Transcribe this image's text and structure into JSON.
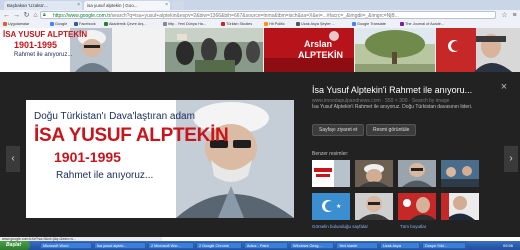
{
  "browser": {
    "tabs": [
      {
        "label": "Başbakan 'Uzakta'...",
        "active": false
      },
      {
        "label": "isa yusuf alptekin | Goo...",
        "active": true
      }
    ],
    "url_domain": "https://www.google.com.tr",
    "url_path": "/search?q=isa+yusuf+alptekin&espv=2&biw=1366&bih=667&source=lnms&tbm=isch&sa=X&ei=...#facrc=_&imgdii=_&imgrc=NjB...",
    "bookmarks": [
      {
        "label": "Uygulamalar",
        "color": "#e35d2e"
      },
      {
        "label": "Google",
        "color": "#4285f4"
      },
      {
        "label": "Facebook",
        "color": "#3b5998"
      },
      {
        "label": "Akademik Çevre Arş...",
        "color": "#2e7d32"
      },
      {
        "label": "http - Yeni Dünya Ha...",
        "color": "#888888"
      },
      {
        "label": "Türkish Studies",
        "color": "#c62828"
      },
      {
        "label": "Hit Politic",
        "color": "#ff9800"
      },
      {
        "label": "Uzak Asya Şeyler ...",
        "color": "#555555"
      },
      {
        "label": "Google Translate",
        "color": "#4285f4"
      },
      {
        "label": "The Journal of Acade...",
        "color": "#7b1fa2"
      }
    ]
  },
  "results": {
    "thumb1_line1": "İSA YUSUF ALPTEKİN",
    "thumb1_years": "1901-1995",
    "thumb1_rahmet": "Rahmet ile anıyoruz...",
    "thumb3_text1": "Arslan",
    "thumb3_text2": "ALPTEKİN"
  },
  "viewer": {
    "close_glyph": "×",
    "prev_glyph": "‹",
    "next_glyph": "›",
    "main_image": {
      "line1": "Doğu Türkistan'ı Dava'laştıran adam",
      "name": "İSA YUSUF ALPTEKİN",
      "years": "1901-1995",
      "rahmet": "Rahmet ile anıyoruz..."
    },
    "info": {
      "title": "İsa Yusuf Alptekin'i Rahmet ile anıyoru...",
      "url": "www.imoodapulpandnews.com · 550 × 300 · Search by image",
      "description": "İsa Yusuf Alptekin'i Rahmet ile anıyoruz. Doğu Türkistan davasının lideri.",
      "visit_button": "Sayfayı ziyaret et",
      "view_button": "Resmi görüntüle",
      "related_label": "Benzer resimler:",
      "related_more": "Görselin bulunduğu sayfalar",
      "related_more2": "Tüm boyutlar"
    }
  },
  "statusbar": {
    "text": "www.google.com.tr/url?sa=i&rct=j&q=&esrc=s..."
  },
  "taskbar": {
    "start_label": "Başlat",
    "clock": "09:56",
    "tasks": [
      "Microsoft Word",
      "İsa yusuf alptek...",
      "2 Microsoft Wor...",
      "2 Google Chrome",
      "Adsız - Paint",
      "Windows Gezg...",
      "Yeni klasör",
      "Uzak Asya",
      "Dosya Yükl..."
    ]
  },
  "colors": {
    "viewer_bg": "#222222",
    "title_red": "#c8141a",
    "title_navy": "#1b2c5c",
    "taskbar_blue": "#245edb",
    "start_green": "#3c9a3e"
  }
}
